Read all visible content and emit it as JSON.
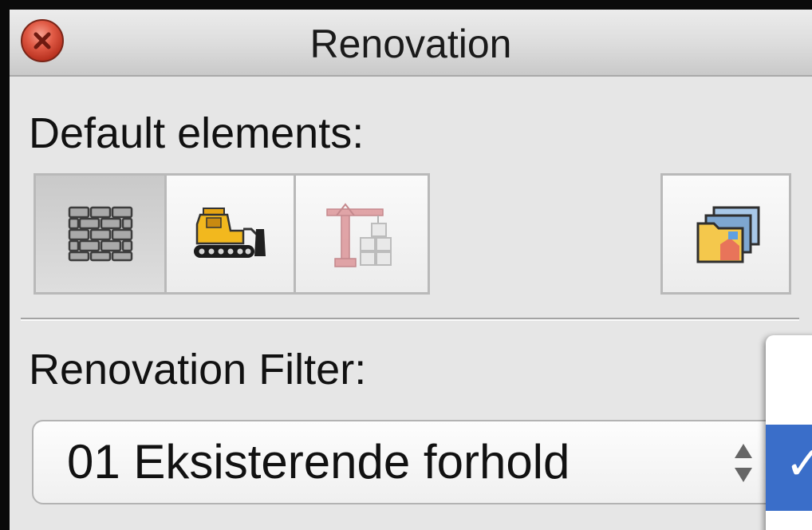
{
  "window": {
    "title": "Renovation"
  },
  "default_elements": {
    "label": "Default elements:",
    "buttons": [
      {
        "name": "existing-elements",
        "icon": "brick-wall-icon",
        "pressed": true
      },
      {
        "name": "demolished-elements",
        "icon": "bulldozer-icon",
        "pressed": false
      },
      {
        "name": "new-elements",
        "icon": "crane-icon",
        "pressed": false,
        "dimmed": true
      },
      {
        "name": "renovation-palette",
        "icon": "layers-folders-icon",
        "pressed": false
      }
    ]
  },
  "renovation_filter": {
    "label": "Renovation Filter:",
    "selected": "01 Eksisterende forhold"
  },
  "popup_menu": {
    "checked_mark": "✓"
  },
  "colors": {
    "window_bg": "#e6e6e6",
    "selection_blue": "#3a6ec9",
    "close_red": "#d9493a",
    "crane_red": "#d9868a",
    "bulldozer_yellow": "#f2b81e"
  }
}
